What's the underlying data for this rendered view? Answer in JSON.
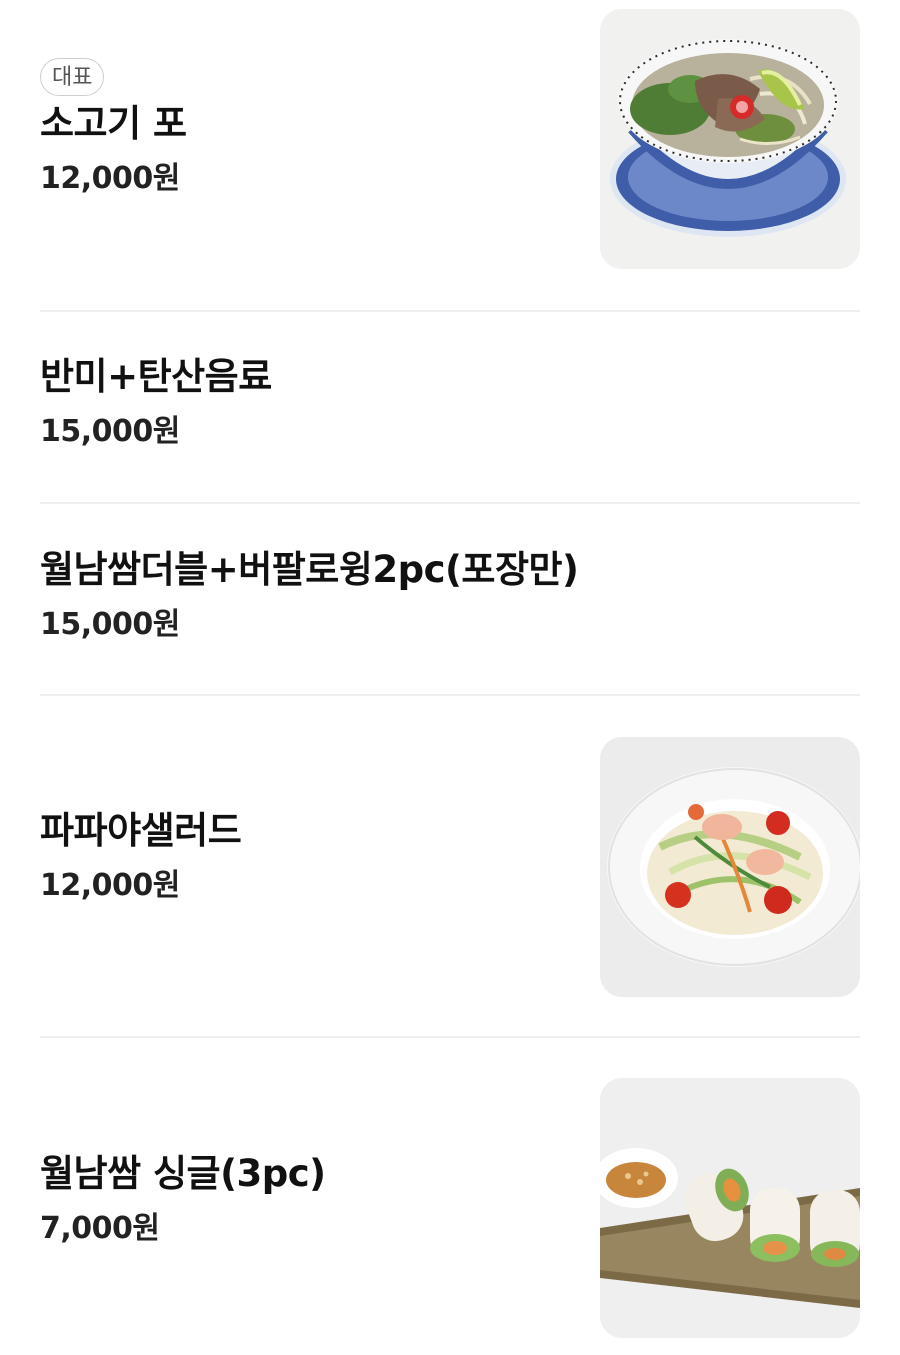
{
  "menu": {
    "items": [
      {
        "badge": "대표",
        "name": "소고기 포",
        "price": "12,000원",
        "image": "beef-pho-photo"
      },
      {
        "name": "반미+탄산음료",
        "price": "15,000원"
      },
      {
        "name": "월남쌈더블+버팔로윙2pc(포장만)",
        "price": "15,000원"
      },
      {
        "name": "파파야샐러드",
        "price": "12,000원",
        "image": "papaya-salad-photo"
      },
      {
        "name": "월남쌈 싱글(3pc)",
        "price": "7,000원",
        "image": "spring-roll-photo"
      }
    ]
  }
}
